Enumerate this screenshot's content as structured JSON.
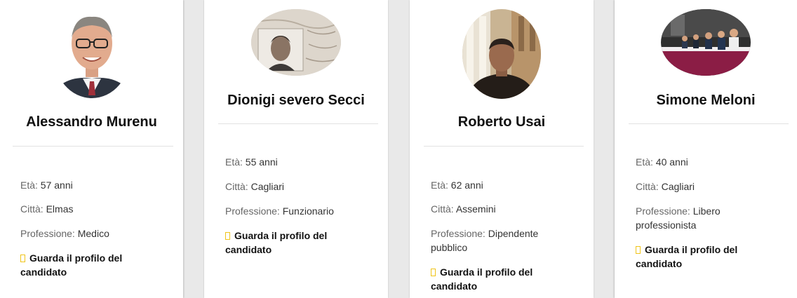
{
  "labels": {
    "age": "Età:",
    "city": "Città:",
    "profession": "Professione:"
  },
  "candidates": [
    {
      "name": "Alessandro Murenu",
      "age": "57 anni",
      "city": "Elmas",
      "profession": "Medico",
      "link": "Guarda il profilo del candidato"
    },
    {
      "name": "Dionigi severo Secci",
      "age": "55 anni",
      "city": "Cagliari",
      "profession": "Funzionario",
      "link": "Guarda il profilo del candidato"
    },
    {
      "name": "Roberto Usai",
      "age": "62 anni",
      "city": "Assemini",
      "profession": "Dipendente pubblico",
      "link": "Guarda il profilo del candidato"
    },
    {
      "name": "Simone Meloni",
      "age": "40 anni",
      "city": "Cagliari",
      "profession": "Libero professionista",
      "link": "Guarda il profilo del candidato"
    }
  ],
  "colors": {
    "link_icon": "#f0c419",
    "background": "#e9e9e9"
  }
}
